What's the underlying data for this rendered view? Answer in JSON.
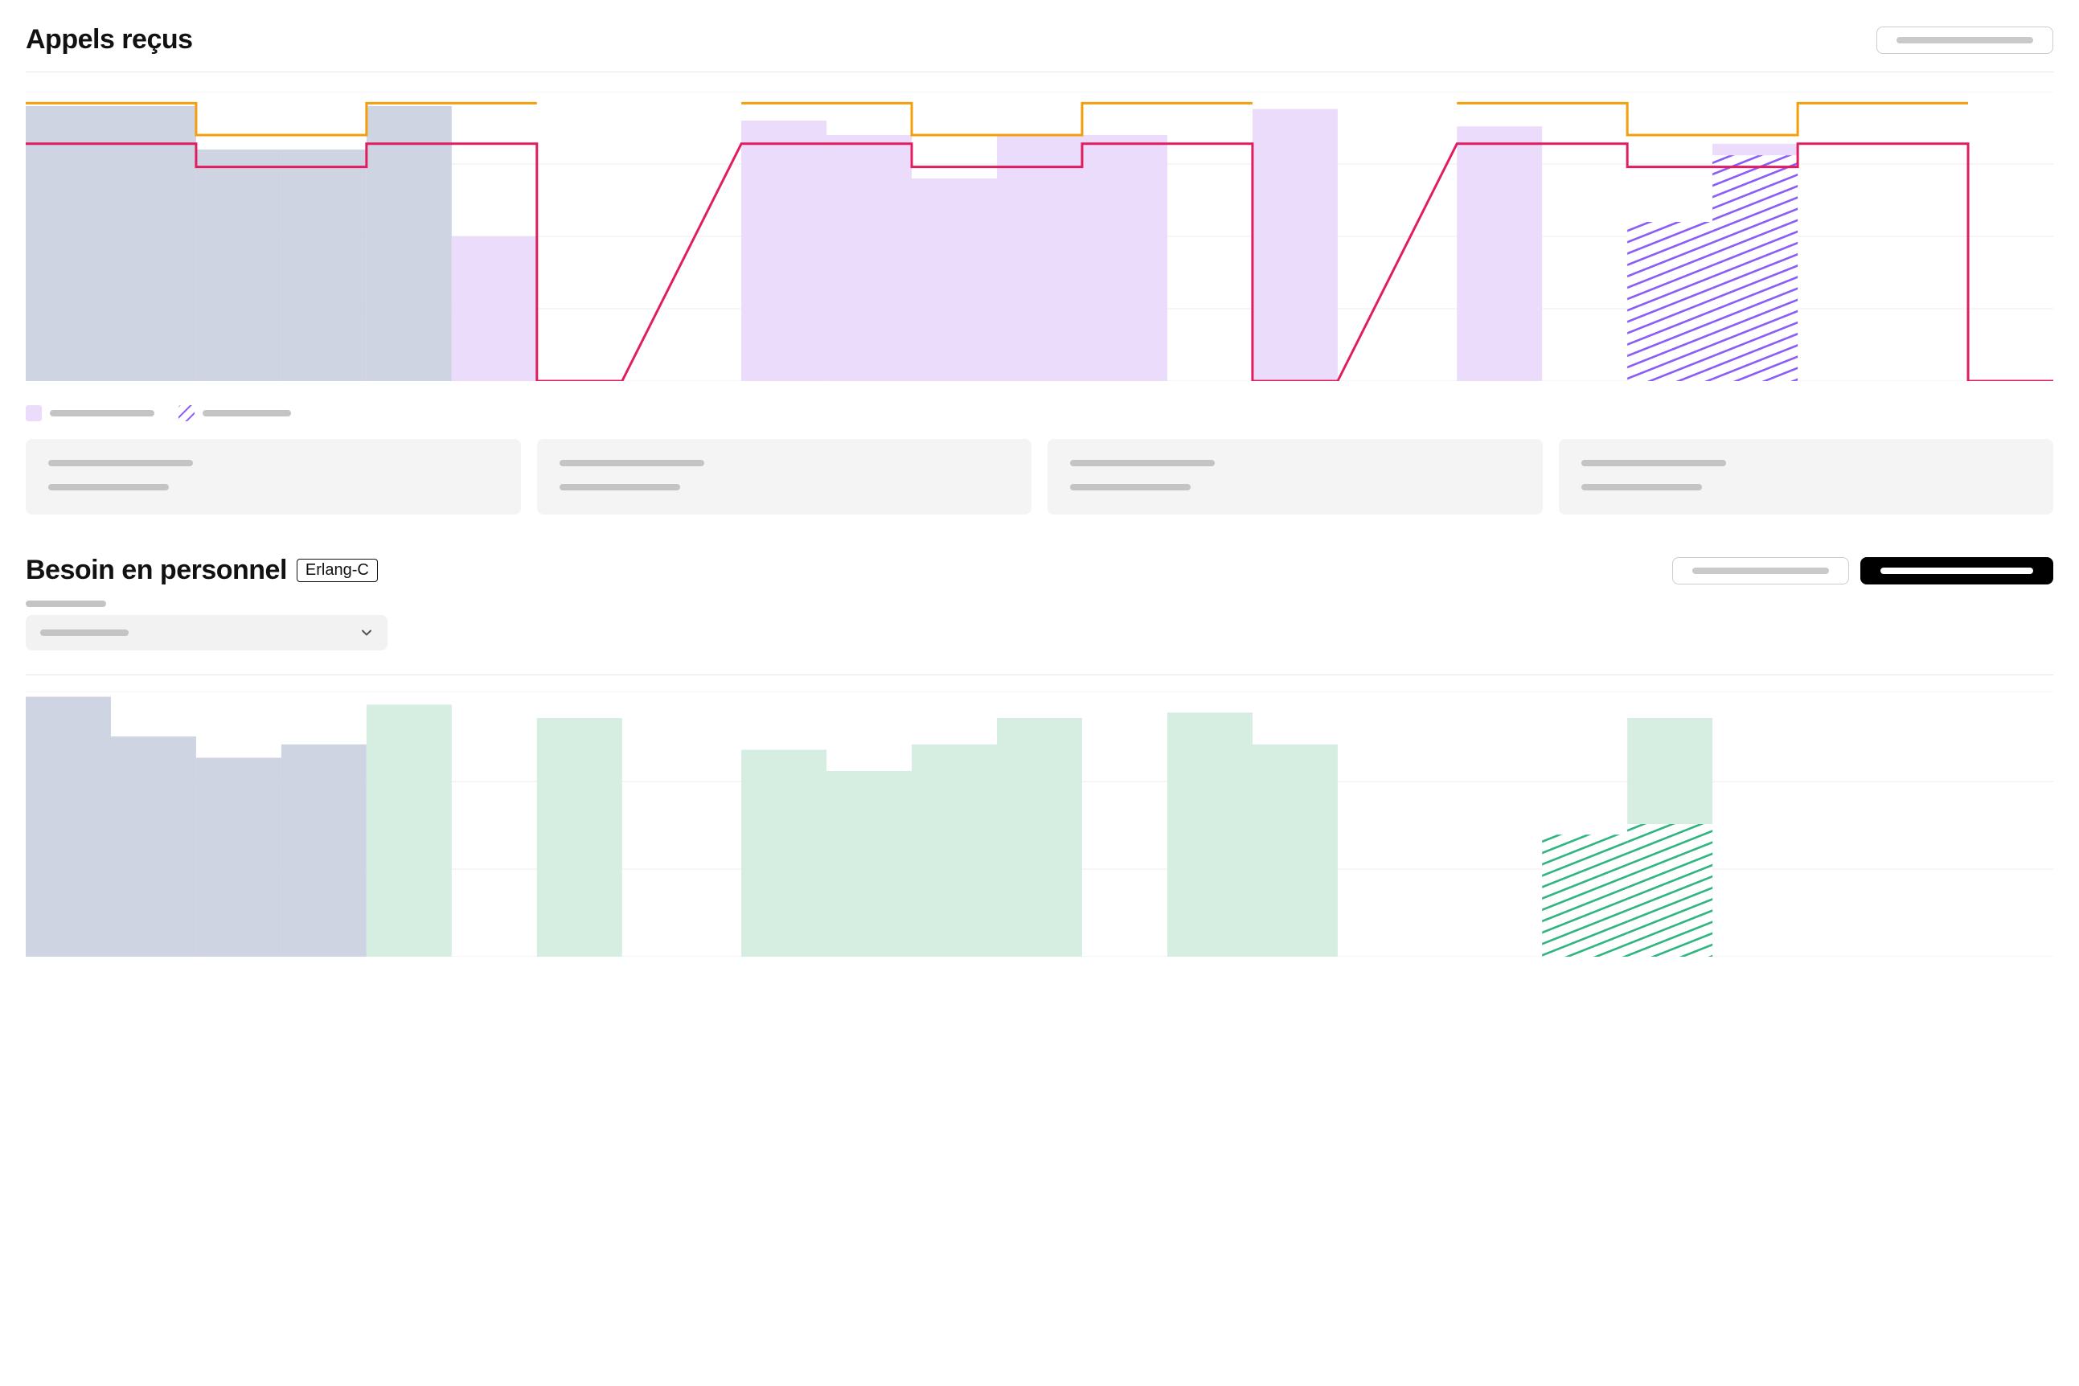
{
  "section1": {
    "title": "Appels reçus",
    "action_label": ""
  },
  "section2": {
    "title": "Besoin en personnel",
    "badge": "Erlang-C",
    "action_outline": "",
    "action_solid": ""
  },
  "chart_data": [
    {
      "type": "bar",
      "title": "Appels reçus",
      "ylim": [
        0,
        100
      ],
      "y_gridlines": [
        0,
        25,
        50,
        75,
        100
      ],
      "group_gap_pct": 5,
      "series": [
        {
          "name": "historical",
          "style": "bar",
          "fill": "#cfd4e2",
          "values": [
            95,
            95,
            80,
            80,
            95,
            50,
            null,
            null,
            null,
            null,
            null,
            null,
            null,
            null,
            null,
            null,
            null,
            null,
            null,
            null,
            null
          ]
        },
        {
          "name": "forecast",
          "style": "bar",
          "fill": "#eadcfa",
          "values": [
            null,
            null,
            null,
            null,
            null,
            50,
            null,
            90,
            85,
            70,
            85,
            85,
            null,
            94,
            88,
            null,
            null,
            82,
            null
          ],
          "note": "index 5 overlays historical at reduced height"
        },
        {
          "name": "forecast-adjusted",
          "style": "bar-hatched",
          "hatch": "hatch-purple",
          "values": [
            null,
            null,
            null,
            null,
            null,
            null,
            null,
            null,
            null,
            null,
            null,
            null,
            null,
            null,
            null,
            null,
            55,
            78,
            null
          ]
        },
        {
          "name": "upper-step",
          "style": "step",
          "stroke": "#f59e0b",
          "values": [
            96,
            96,
            85,
            85,
            96,
            96,
            null,
            96,
            96,
            85,
            85,
            96,
            96,
            null,
            96,
            96,
            85,
            85,
            96,
            96,
            null
          ]
        },
        {
          "name": "lower-step",
          "style": "step",
          "stroke": "#e11d5f",
          "values": [
            82,
            82,
            74,
            74,
            82,
            82,
            0,
            82,
            82,
            74,
            74,
            82,
            82,
            0,
            82,
            82,
            74,
            74,
            82,
            82,
            0
          ]
        }
      ],
      "legend": [
        {
          "swatch_fill": "#eadcfa"
        },
        {
          "swatch_hatch": "hatch-purple"
        }
      ]
    },
    {
      "type": "bar",
      "title": "Besoin en personnel",
      "ylim": [
        0,
        100
      ],
      "y_gridlines": [
        0,
        33,
        66,
        100
      ],
      "group_gap_pct": 5,
      "series": [
        {
          "name": "historical",
          "style": "bar",
          "fill": "#cfd4e2",
          "values": [
            98,
            83,
            75,
            80,
            null,
            null,
            null,
            null,
            null,
            null,
            null,
            null,
            null,
            null,
            null,
            null,
            null,
            null,
            null,
            null,
            null
          ]
        },
        {
          "name": "planned",
          "style": "bar",
          "fill": "#d6ede2",
          "values": [
            null,
            null,
            null,
            null,
            95,
            null,
            90,
            78,
            70,
            80,
            90,
            null,
            92,
            80,
            null,
            null,
            90,
            null
          ]
        },
        {
          "name": "planned-adjusted",
          "style": "bar-hatched",
          "hatch": "hatch-green",
          "values": [
            null,
            null,
            null,
            null,
            null,
            null,
            null,
            null,
            null,
            null,
            null,
            null,
            null,
            null,
            null,
            46,
            50,
            null,
            null
          ]
        }
      ]
    }
  ]
}
